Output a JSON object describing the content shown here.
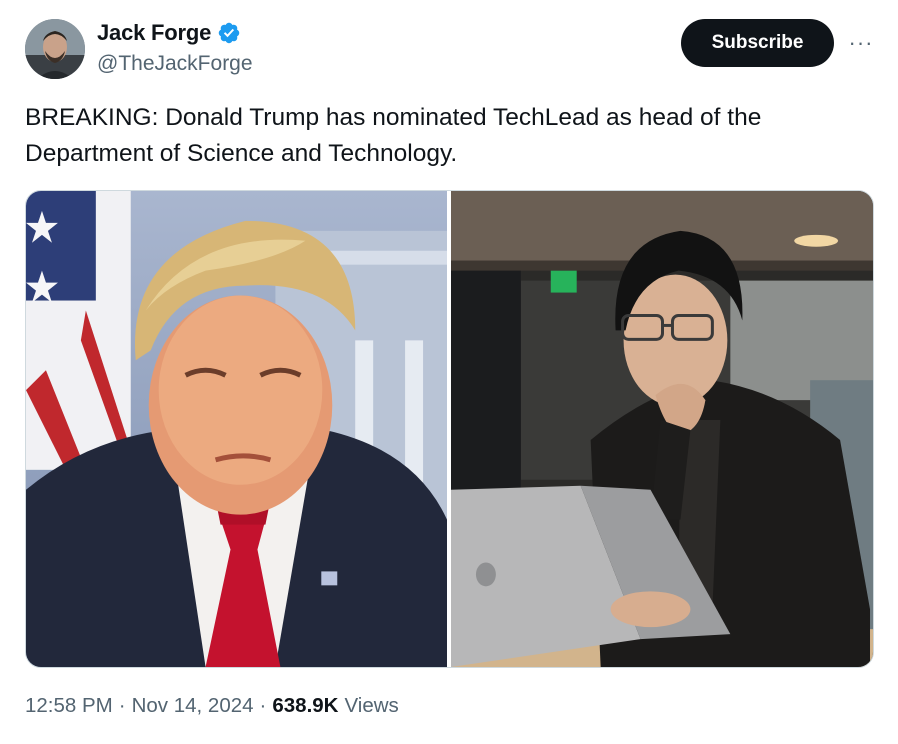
{
  "author": {
    "display_name": "Jack Forge",
    "handle": "@TheJackForge",
    "verified": true,
    "avatar_icon": "profile-photo"
  },
  "actions": {
    "subscribe_label": "Subscribe",
    "more_label": "···"
  },
  "tweet": {
    "text": "BREAKING: Donald Trump has nominated TechLead as head of the Department of Science and Technology."
  },
  "meta": {
    "time": "12:58 PM",
    "separator1": "·",
    "date": "Nov 14, 2024",
    "separator2": "·",
    "views_count": "638.9K",
    "views_label": "Views"
  },
  "colors": {
    "primary_text": "#0f1419",
    "secondary_text": "#536471",
    "verified_blue": "#1d9bf0",
    "button_bg": "#0f1419"
  }
}
